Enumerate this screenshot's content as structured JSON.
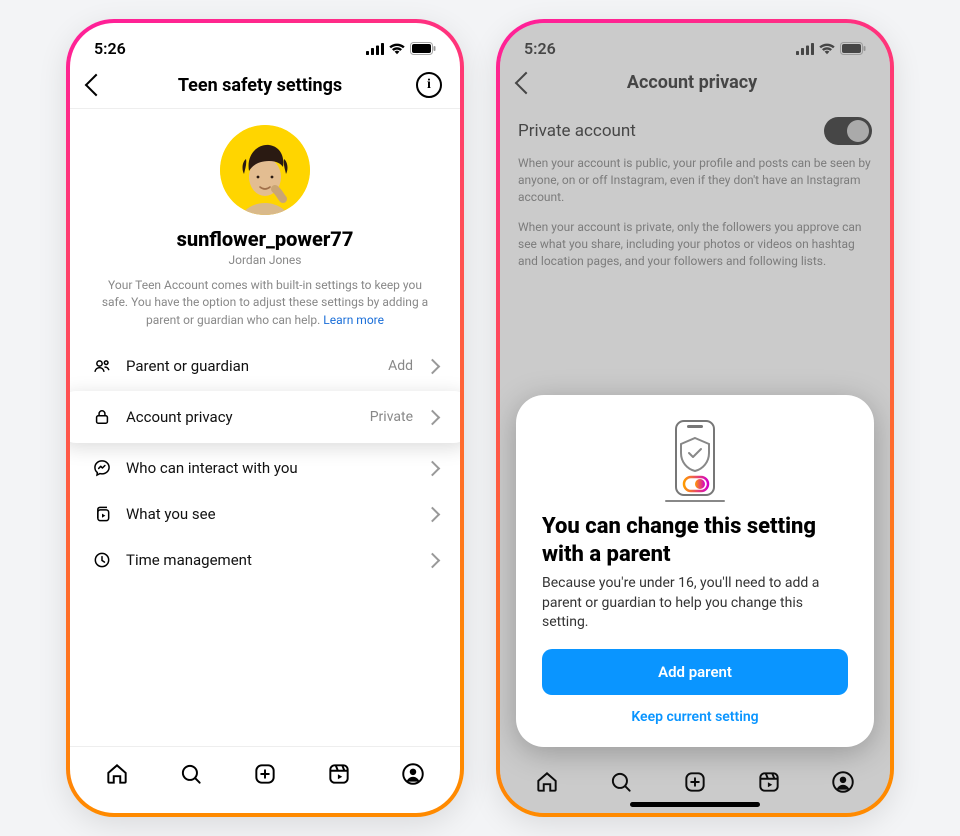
{
  "status": {
    "time": "5:26"
  },
  "phone1": {
    "title": "Teen safety settings",
    "username": "sunflower_power77",
    "realname": "Jordan Jones",
    "description": "Your Teen Account comes with built-in settings to keep you safe. You have the option to adjust these settings by adding a parent or guardian who can help. ",
    "learn_more": "Learn more",
    "rows": {
      "parent": {
        "label": "Parent or guardian",
        "value": "Add"
      },
      "privacy": {
        "label": "Account privacy",
        "value": "Private"
      },
      "interact": {
        "label": "Who can interact with you",
        "value": ""
      },
      "see": {
        "label": "What you see",
        "value": ""
      },
      "time": {
        "label": "Time management",
        "value": ""
      }
    }
  },
  "phone2": {
    "title": "Account privacy",
    "toggle_label": "Private account",
    "para1": "When your account is public, your profile and posts can be seen by anyone, on or off Instagram, even if they don't have an Instagram account.",
    "para2": "When your account is private, only the followers you approve can see what you share, including your photos or videos on hashtag and location pages, and your followers and following lists.",
    "sheet": {
      "heading": "You can change this setting with a parent",
      "body": "Because you're under 16, you'll need to add a parent or guardian to help you change this setting.",
      "primary": "Add parent",
      "secondary": "Keep current setting"
    }
  }
}
